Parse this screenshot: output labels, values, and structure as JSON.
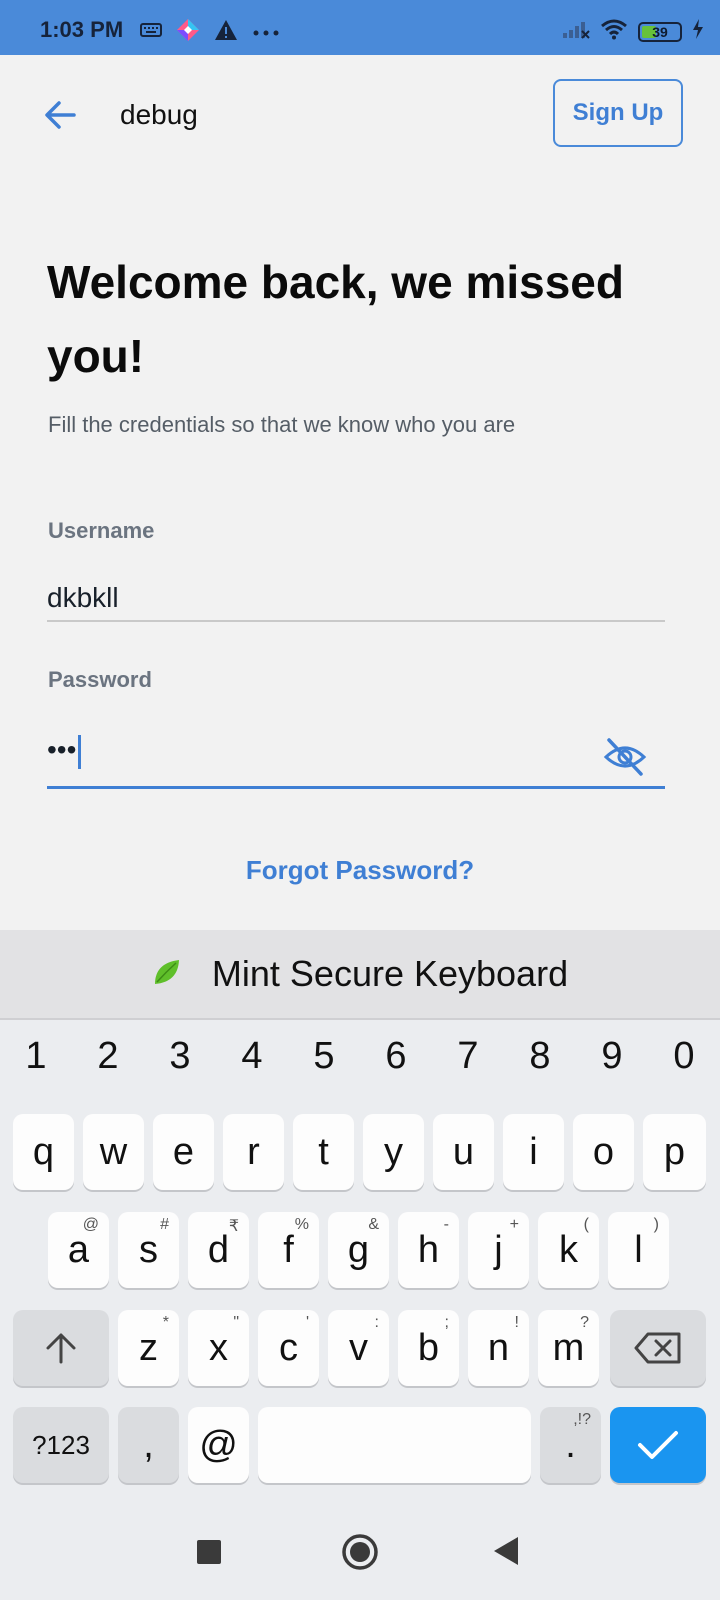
{
  "status_bar": {
    "time": "1:03 PM",
    "battery": "39"
  },
  "app_bar": {
    "title": "debug",
    "sign_up": "Sign Up"
  },
  "welcome": {
    "heading": "Welcome back, we missed you!",
    "subtitle": "Fill the credentials so that we know who you are"
  },
  "form": {
    "username_label": "Username",
    "username_value": "dkbkll",
    "password_label": "Password",
    "password_value": "•••"
  },
  "forgot_password": "Forgot Password?",
  "keyboard": {
    "title": "Mint Secure Keyboard",
    "numbers": [
      "1",
      "2",
      "3",
      "4",
      "5",
      "6",
      "7",
      "8",
      "9",
      "0"
    ],
    "row1": [
      "q",
      "w",
      "e",
      "r",
      "t",
      "y",
      "u",
      "i",
      "o",
      "p"
    ],
    "row2": [
      [
        "a",
        "@"
      ],
      [
        "s",
        "#"
      ],
      [
        "d",
        "₹"
      ],
      [
        "f",
        "%"
      ],
      [
        "g",
        "&"
      ],
      [
        "h",
        "-"
      ],
      [
        "j",
        "+"
      ],
      [
        "k",
        "("
      ],
      [
        "l",
        ")"
      ]
    ],
    "row3": [
      [
        "z",
        "*"
      ],
      [
        "x",
        "\""
      ],
      [
        "c",
        "'"
      ],
      [
        "v",
        ":"
      ],
      [
        "b",
        ";"
      ],
      [
        "n",
        "!"
      ],
      [
        "m",
        "?"
      ]
    ],
    "sym_key": "?123",
    "comma_key": ",",
    "at_key": "@",
    "period_key": ".",
    "period_alt": ",!?"
  },
  "colors": {
    "accent": "#3f7fd4",
    "status_bar": "#4a8ad9",
    "done_key": "#1a95f0"
  }
}
